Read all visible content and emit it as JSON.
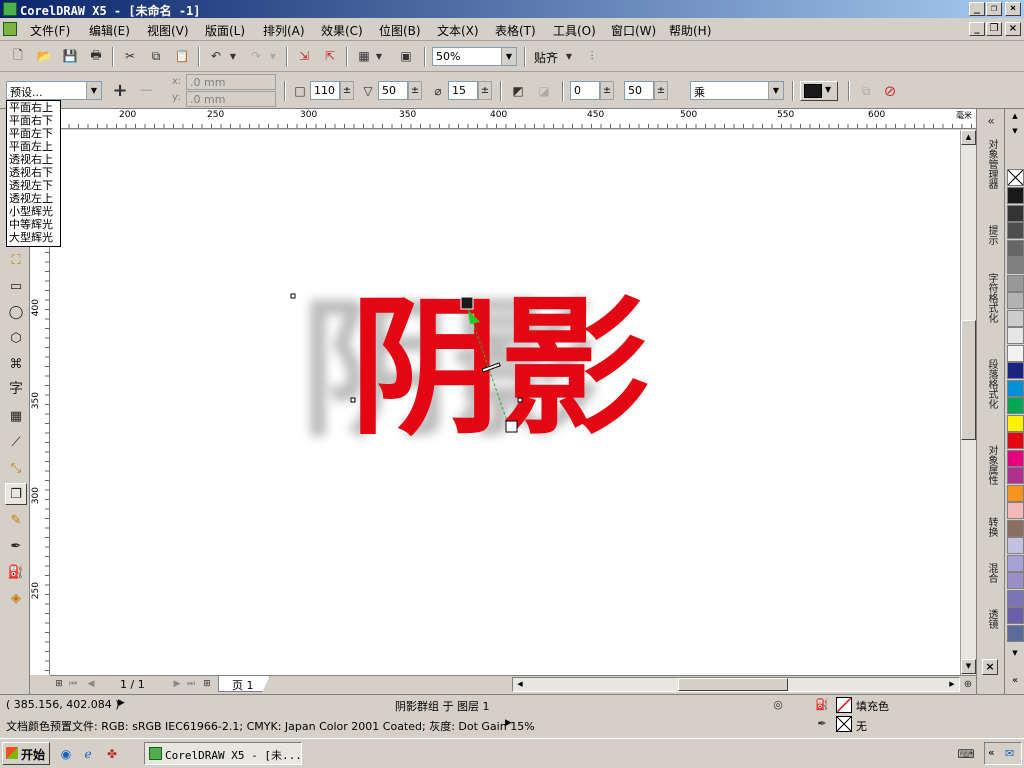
{
  "window": {
    "title": "CorelDRAW X5 - [未命名 -1]",
    "controls": [
      "_",
      "❐",
      "×"
    ],
    "doc_controls": [
      "_",
      "❐",
      "×"
    ]
  },
  "menus": [
    "文件(F)",
    "编辑(E)",
    "视图(V)",
    "版面(L)",
    "排列(A)",
    "效果(C)",
    "位图(B)",
    "文本(X)",
    "表格(T)",
    "工具(O)",
    "窗口(W)",
    "帮助(H)"
  ],
  "toolbar": {
    "zoom": "50%",
    "snap_label": "贴齐"
  },
  "propbar": {
    "preset": "预设...",
    "x_offset": ".0 mm",
    "y_offset": ".0 mm",
    "x_label": "x:",
    "y_label": "y:",
    "opacity": "110",
    "feather": "50",
    "angle": "15",
    "fade": "0",
    "stretch": "50",
    "merge_mode": "乘",
    "shadow_color": "#1a1a1a"
  },
  "preset_list": [
    "平面右上",
    "平面右下",
    "平面左下",
    "平面左上",
    "透视右上",
    "透视右下",
    "透视左下",
    "透视左上",
    "小型辉光",
    "中等辉光",
    "大型辉光"
  ],
  "ruler": {
    "h_labels": [
      "200",
      "250",
      "300",
      "350",
      "400",
      "450",
      "500",
      "550",
      "600"
    ],
    "unit": "毫米",
    "v_labels": [
      "400",
      "350",
      "300",
      "250"
    ]
  },
  "canvas": {
    "text": "阴影",
    "text_color": "#e30613",
    "shadow_color": "#b0b0b0"
  },
  "docker_tabs": [
    "对象管理器",
    "提示",
    "字符格式化",
    "段落格式化",
    "对象属性",
    "转换",
    "混合",
    "透镜"
  ],
  "palette": [
    "#ffffff",
    "#1a1a1a",
    "#333333",
    "#4d4d4d",
    "#666666",
    "#808080",
    "#999999",
    "#b3b3b3",
    "#cccccc",
    "#e6e6e6",
    "#f2f2f2",
    "#1a237e",
    "#0090d8",
    "#00a651",
    "#fff200",
    "#e30613",
    "#e4007f",
    "#b0308f",
    "#f7941d",
    "#f4b8b8",
    "#8c6d62",
    "#c4c0e0",
    "#a6a0d4",
    "#9a8fc8",
    "#7d74b8",
    "#6a5fa8",
    "#5a6c9a"
  ],
  "pager": {
    "count": "1 / 1",
    "tab": "页 1"
  },
  "status": {
    "coords": "( 385.156, 402.084 )",
    "selection": "阴影群组 于 图层 1",
    "color_profile": "文档颜色预置文件: RGB: sRGB IEC61966-2.1; CMYK: Japan Color 2001 Coated; 灰度: Dot Gain 15%",
    "fill_label": "填充色",
    "outline_label": "无"
  },
  "taskbar": {
    "start": "开始",
    "task": "CorelDRAW X5 - [未..."
  }
}
